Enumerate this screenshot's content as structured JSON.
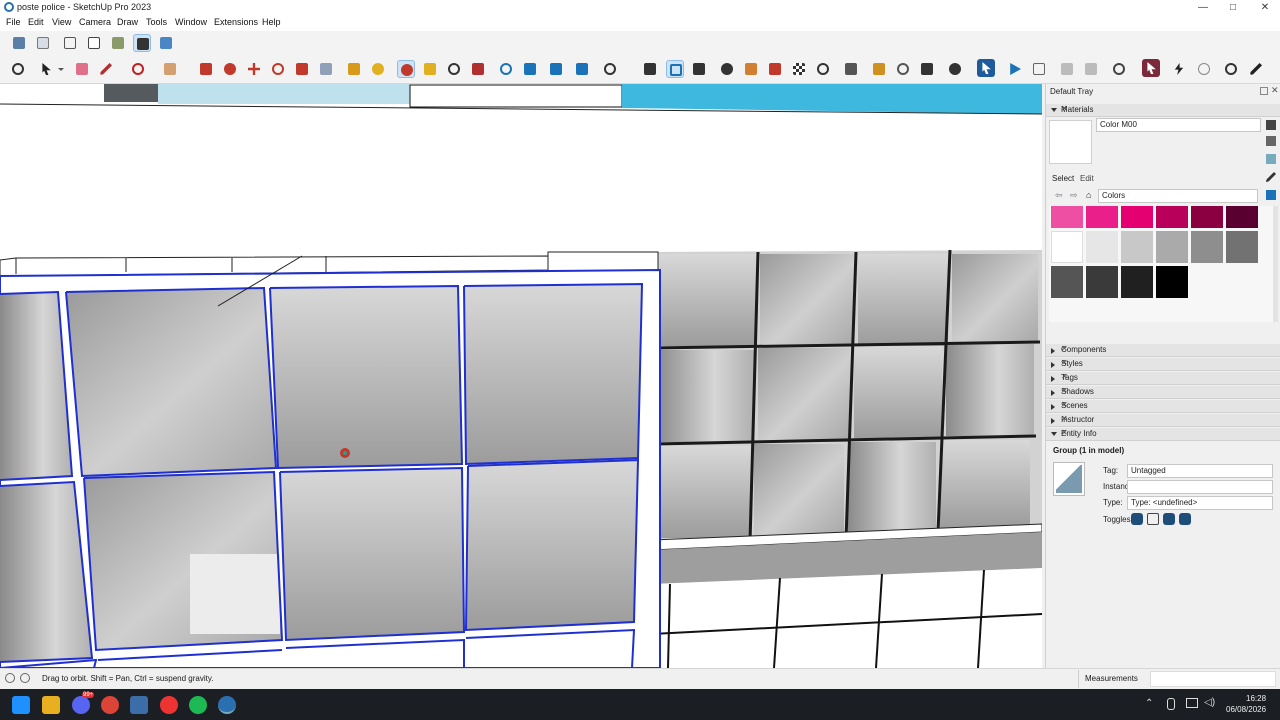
{
  "window": {
    "title": "poste police - SketchUp Pro 2023"
  },
  "window_controls": {
    "minimize": "—",
    "maximize": "□",
    "close": "✕"
  },
  "menu": [
    "File",
    "Edit",
    "View",
    "Camera",
    "Draw",
    "Tools",
    "Window",
    "Extensions",
    "Help"
  ],
  "toolbar1_icons": [
    "xray-icon",
    "back-edges-icon",
    "wireframe-icon",
    "hidden-line-icon",
    "shaded-icon",
    "shaded-textures-icon",
    "monochrome-icon"
  ],
  "toolbar2_icons": [
    "zoom-icon",
    "select-icon",
    "eraser-icon",
    "pencil-icon",
    "shapes-icon",
    "rectangle-icon",
    "paint-bucket-icon",
    "push-pull-icon",
    "move-icon",
    "rotate-icon",
    "scale-icon",
    "offset-icon",
    "tape-measure-icon",
    "protractor-icon",
    "orbit-icon",
    "walk-icon",
    "zoom-window-icon",
    "zoom-extents-icon",
    "section-plane-icon",
    "sandbox-icon",
    "layers-icon",
    "styles-icon",
    "user-icon",
    "warehouse-icon",
    "component-icon",
    "add-location-icon",
    "photo-icon",
    "checker-icon",
    "cloud-icon",
    "extension-icon",
    "folder-icon",
    "info-icon",
    "cart-icon",
    "account-icon",
    "profile-icon",
    "play-icon",
    "stop-icon",
    "video-icon",
    "camera-icon",
    "settings-icon",
    "ruby-icon",
    "lightning-icon",
    "close-circle-icon",
    "bulb-icon",
    "pen-icon"
  ],
  "tray": {
    "title": "Default Tray",
    "materials": {
      "header": "Materials",
      "material_name": "Color M00",
      "select_tab": "Select",
      "edit_tab": "Edit",
      "library": "Colors",
      "swatch_colors": [
        "#e62ce1",
        "#b516b6",
        "#8c1596",
        "#5c0f5c",
        "#f5b7dc",
        "#f77fcf",
        "#ee4fa2",
        "#ea1f8a",
        "#e40070",
        "#b8005a",
        "#8b0040",
        "#5a0030",
        "#ffffff",
        "#e6e6e6",
        "#c8c8c8",
        "#aaaaaa",
        "#8e8e8e",
        "#727272",
        "#555555",
        "#3a3a3a",
        "#202020",
        "#000000"
      ]
    },
    "sections": [
      "Components",
      "Styles",
      "Tags",
      "Shadows",
      "Scenes",
      "Instructor"
    ],
    "entity_info": {
      "header": "Entity Info",
      "entity": "Group (1 in model)",
      "tag_label": "Tag:",
      "tag_value": "Untagged",
      "instance_label": "Instance:",
      "instance_value": "",
      "type_label": "Type:",
      "type_value": "Type: <undefined>",
      "toggles_label": "Toggles:"
    }
  },
  "status": {
    "message": "Drag to orbit. Shift = Pan, Ctrl = suspend gravity.",
    "measurements_label": "Measurements"
  },
  "taskbar": {
    "time": "16:28",
    "date": "06/08/2026",
    "discord_badge": "99+"
  }
}
